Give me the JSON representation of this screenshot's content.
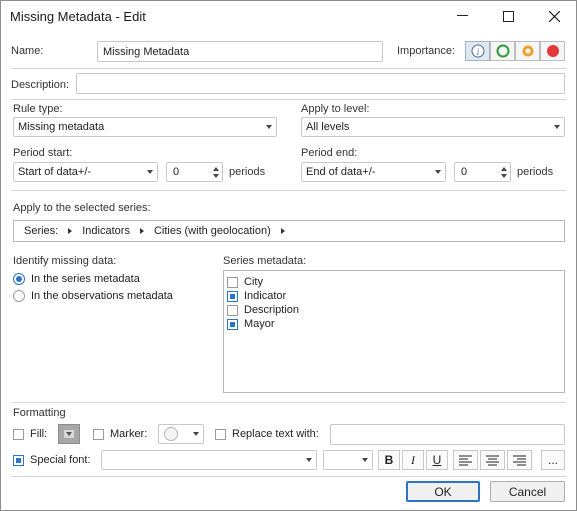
{
  "window": {
    "title": "Missing Metadata - Edit"
  },
  "name": {
    "label": "Name:",
    "value": "Missing Metadata"
  },
  "importance": {
    "label": "Importance:"
  },
  "description": {
    "label": "Description:",
    "value": ""
  },
  "rule_type": {
    "label": "Rule type:",
    "value": "Missing metadata"
  },
  "apply_to_level": {
    "label": "Apply to level:",
    "value": "All levels"
  },
  "period_start": {
    "label": "Period start:",
    "value": "Start of data+/-",
    "offset": "0",
    "unit": "periods"
  },
  "period_end": {
    "label": "Period end:",
    "value": "End of data+/-",
    "offset": "0",
    "unit": "periods"
  },
  "series_selection": {
    "label": "Apply to the selected series:",
    "crumbs": [
      "Series:",
      "Indicators",
      "Cities (with geolocation)"
    ]
  },
  "identify": {
    "label": "Identify missing data:",
    "options": [
      "In the series metadata",
      "In the observations metadata"
    ],
    "selected_index": 0
  },
  "series_metadata": {
    "label": "Series metadata:",
    "items": [
      {
        "label": "City",
        "checked": false
      },
      {
        "label": "Indicator",
        "checked": true
      },
      {
        "label": "Description",
        "checked": false
      },
      {
        "label": "Mayor",
        "checked": true
      }
    ]
  },
  "formatting": {
    "label": "Formatting",
    "fill_label": "Fill:",
    "marker_label": "Marker:",
    "replace_label": "Replace text with:",
    "replace_value": "",
    "special_font_label": "Special font:",
    "special_font_checked": true,
    "font_value": "",
    "size_value": "",
    "bold": "B",
    "italic": "I",
    "underline": "U",
    "more": "..."
  },
  "buttons": {
    "ok": "OK",
    "cancel": "Cancel"
  },
  "colors": {
    "accent": "#2b73c4",
    "importance_green": "#2e9a3a",
    "importance_orange": "#f0a030",
    "importance_red": "#e23a3a"
  }
}
